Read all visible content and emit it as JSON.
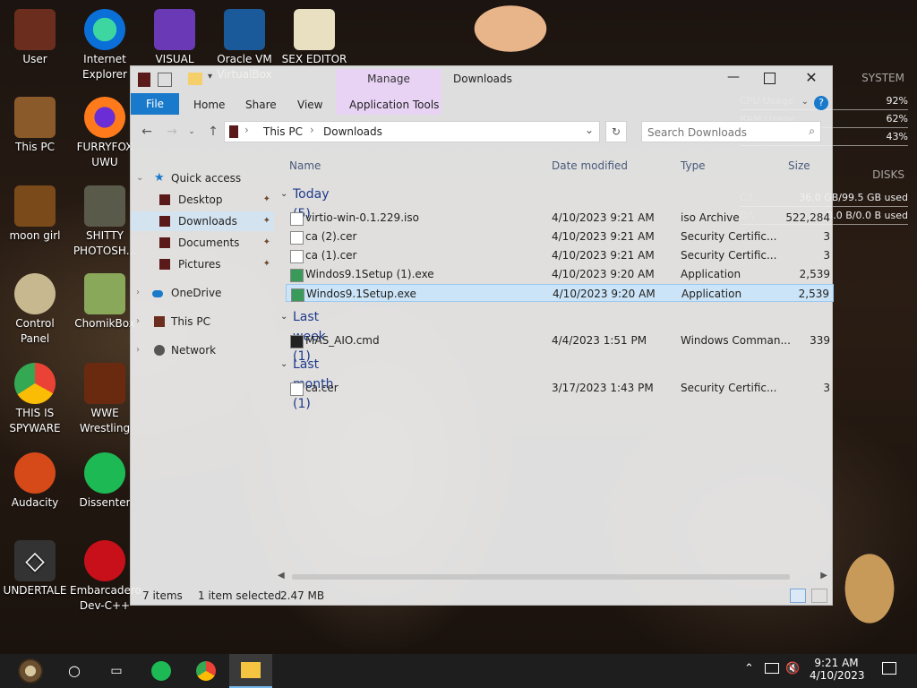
{
  "desktop": {
    "icons": [
      {
        "label": "User"
      },
      {
        "label": "Internet Explorer"
      },
      {
        "label": "VISUAL"
      },
      {
        "label": "Oracle VM VirtualBox"
      },
      {
        "label": "SEX EDITOR"
      },
      {
        "label": "This PC"
      },
      {
        "label": "FURRYFOX UWU"
      },
      {
        "label": "moon girl"
      },
      {
        "label": "SHITTY PHOTOSH..."
      },
      {
        "label": "Control Panel"
      },
      {
        "label": "ChomikBox"
      },
      {
        "label": "THIS IS SPYWARE"
      },
      {
        "label": "WWE Wrestling"
      },
      {
        "label": "Audacity"
      },
      {
        "label": "Dissenter"
      },
      {
        "label": "UNDERTALE"
      },
      {
        "label": "Embarcadero Dev-C++"
      }
    ],
    "rainmeter": {
      "title": "SYSTEM",
      "rows": [
        {
          "key": "CPU Usage",
          "value": "92%"
        },
        {
          "key": "RAM Usage",
          "value": "62%"
        },
        {
          "key": "SWAP Usage",
          "value": "43%"
        }
      ],
      "disks_title": "DISKS",
      "disks": [
        {
          "key": "C:\\",
          "value": "36.0 GB/99.5 GB used"
        },
        {
          "key": "D:\\",
          "value": "0.0 B/0.0 B used"
        }
      ]
    }
  },
  "explorer": {
    "title": "Downloads",
    "manage_label": "Manage",
    "tabs": {
      "file": "File",
      "home": "Home",
      "share": "Share",
      "view": "View",
      "app_tools": "Application Tools"
    },
    "address": {
      "root": "This PC",
      "sep": "›",
      "current": "Downloads"
    },
    "search_placeholder": "Search Downloads",
    "nav": {
      "quick_access": "Quick access",
      "desktop": "Desktop",
      "downloads": "Downloads",
      "documents": "Documents",
      "pictures": "Pictures",
      "onedrive": "OneDrive",
      "this_pc": "This PC",
      "network": "Network"
    },
    "columns": {
      "name": "Name",
      "date": "Date modified",
      "type": "Type",
      "size": "Size"
    },
    "groups": [
      {
        "title": "Today (5)",
        "files": [
          {
            "name": "virtio-win-0.1.229.iso",
            "date": "4/10/2023 9:21 AM",
            "type": "iso Archive",
            "size": "522,284"
          },
          {
            "name": "ca (2).cer",
            "date": "4/10/2023 9:21 AM",
            "type": "Security Certific...",
            "size": "3"
          },
          {
            "name": "ca (1).cer",
            "date": "4/10/2023 9:21 AM",
            "type": "Security Certific...",
            "size": "3"
          },
          {
            "name": "Windos9.1Setup (1).exe",
            "date": "4/10/2023 9:20 AM",
            "type": "Application",
            "size": "2,539"
          },
          {
            "name": "Windos9.1Setup.exe",
            "date": "4/10/2023 9:20 AM",
            "type": "Application",
            "size": "2,539"
          }
        ]
      },
      {
        "title": "Last week (1)",
        "files": [
          {
            "name": "MAS_AIO.cmd",
            "date": "4/4/2023 1:51 PM",
            "type": "Windows Comman...",
            "size": "339"
          }
        ]
      },
      {
        "title": "Last month (1)",
        "files": [
          {
            "name": "ca.cer",
            "date": "3/17/2023 1:43 PM",
            "type": "Security Certific...",
            "size": "3"
          }
        ]
      }
    ],
    "status": {
      "items": "7 items",
      "selected": "1 item selected",
      "size": "2.47 MB"
    }
  },
  "taskbar": {
    "time": "9:21 AM",
    "date": "4/10/2023"
  },
  "colors": {
    "accent": "#1979ca",
    "selection": "#cce4f7",
    "manage": "#e9d3f5",
    "group_text": "#1e3a8a"
  }
}
